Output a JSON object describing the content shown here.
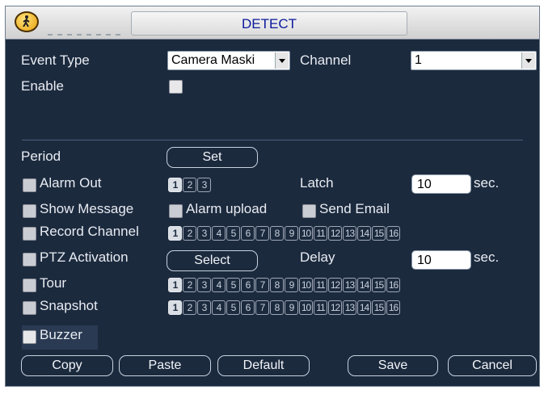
{
  "window": {
    "title": "DETECT"
  },
  "form": {
    "event_type_label": "Event Type",
    "event_type_value": "Camera Maski",
    "channel_label": "Channel",
    "channel_value": "1",
    "enable_label": "Enable",
    "period_label": "Period",
    "set_button": "Set",
    "alarm_out_label": "Alarm Out",
    "alarm_out_channels": [
      "1",
      "2",
      "3"
    ],
    "latch_label": "Latch",
    "latch_value": "10",
    "latch_unit": "sec.",
    "show_message_label": "Show Message",
    "alarm_upload_label": "Alarm upload",
    "send_email_label": "Send Email",
    "record_channel_label": "Record Channel",
    "ptz_activation_label": "PTZ Activation",
    "select_button": "Select",
    "delay_label": "Delay",
    "delay_value": "10",
    "delay_unit": "sec.",
    "tour_label": "Tour",
    "snapshot_label": "Snapshot",
    "buzzer_label": "Buzzer",
    "channels": [
      "1",
      "2",
      "3",
      "4",
      "5",
      "6",
      "7",
      "8",
      "9",
      "10",
      "11",
      "12",
      "13",
      "14",
      "15",
      "16"
    ]
  },
  "buttons": {
    "copy": "Copy",
    "paste": "Paste",
    "default": "Default",
    "save": "Save",
    "cancel": "Cancel"
  },
  "icons": {
    "logo": "walking-person-icon"
  },
  "colors": {
    "panel": "#1c2a3e",
    "title_text": "#0b1a9b",
    "label_text": "#e8ecf2"
  }
}
